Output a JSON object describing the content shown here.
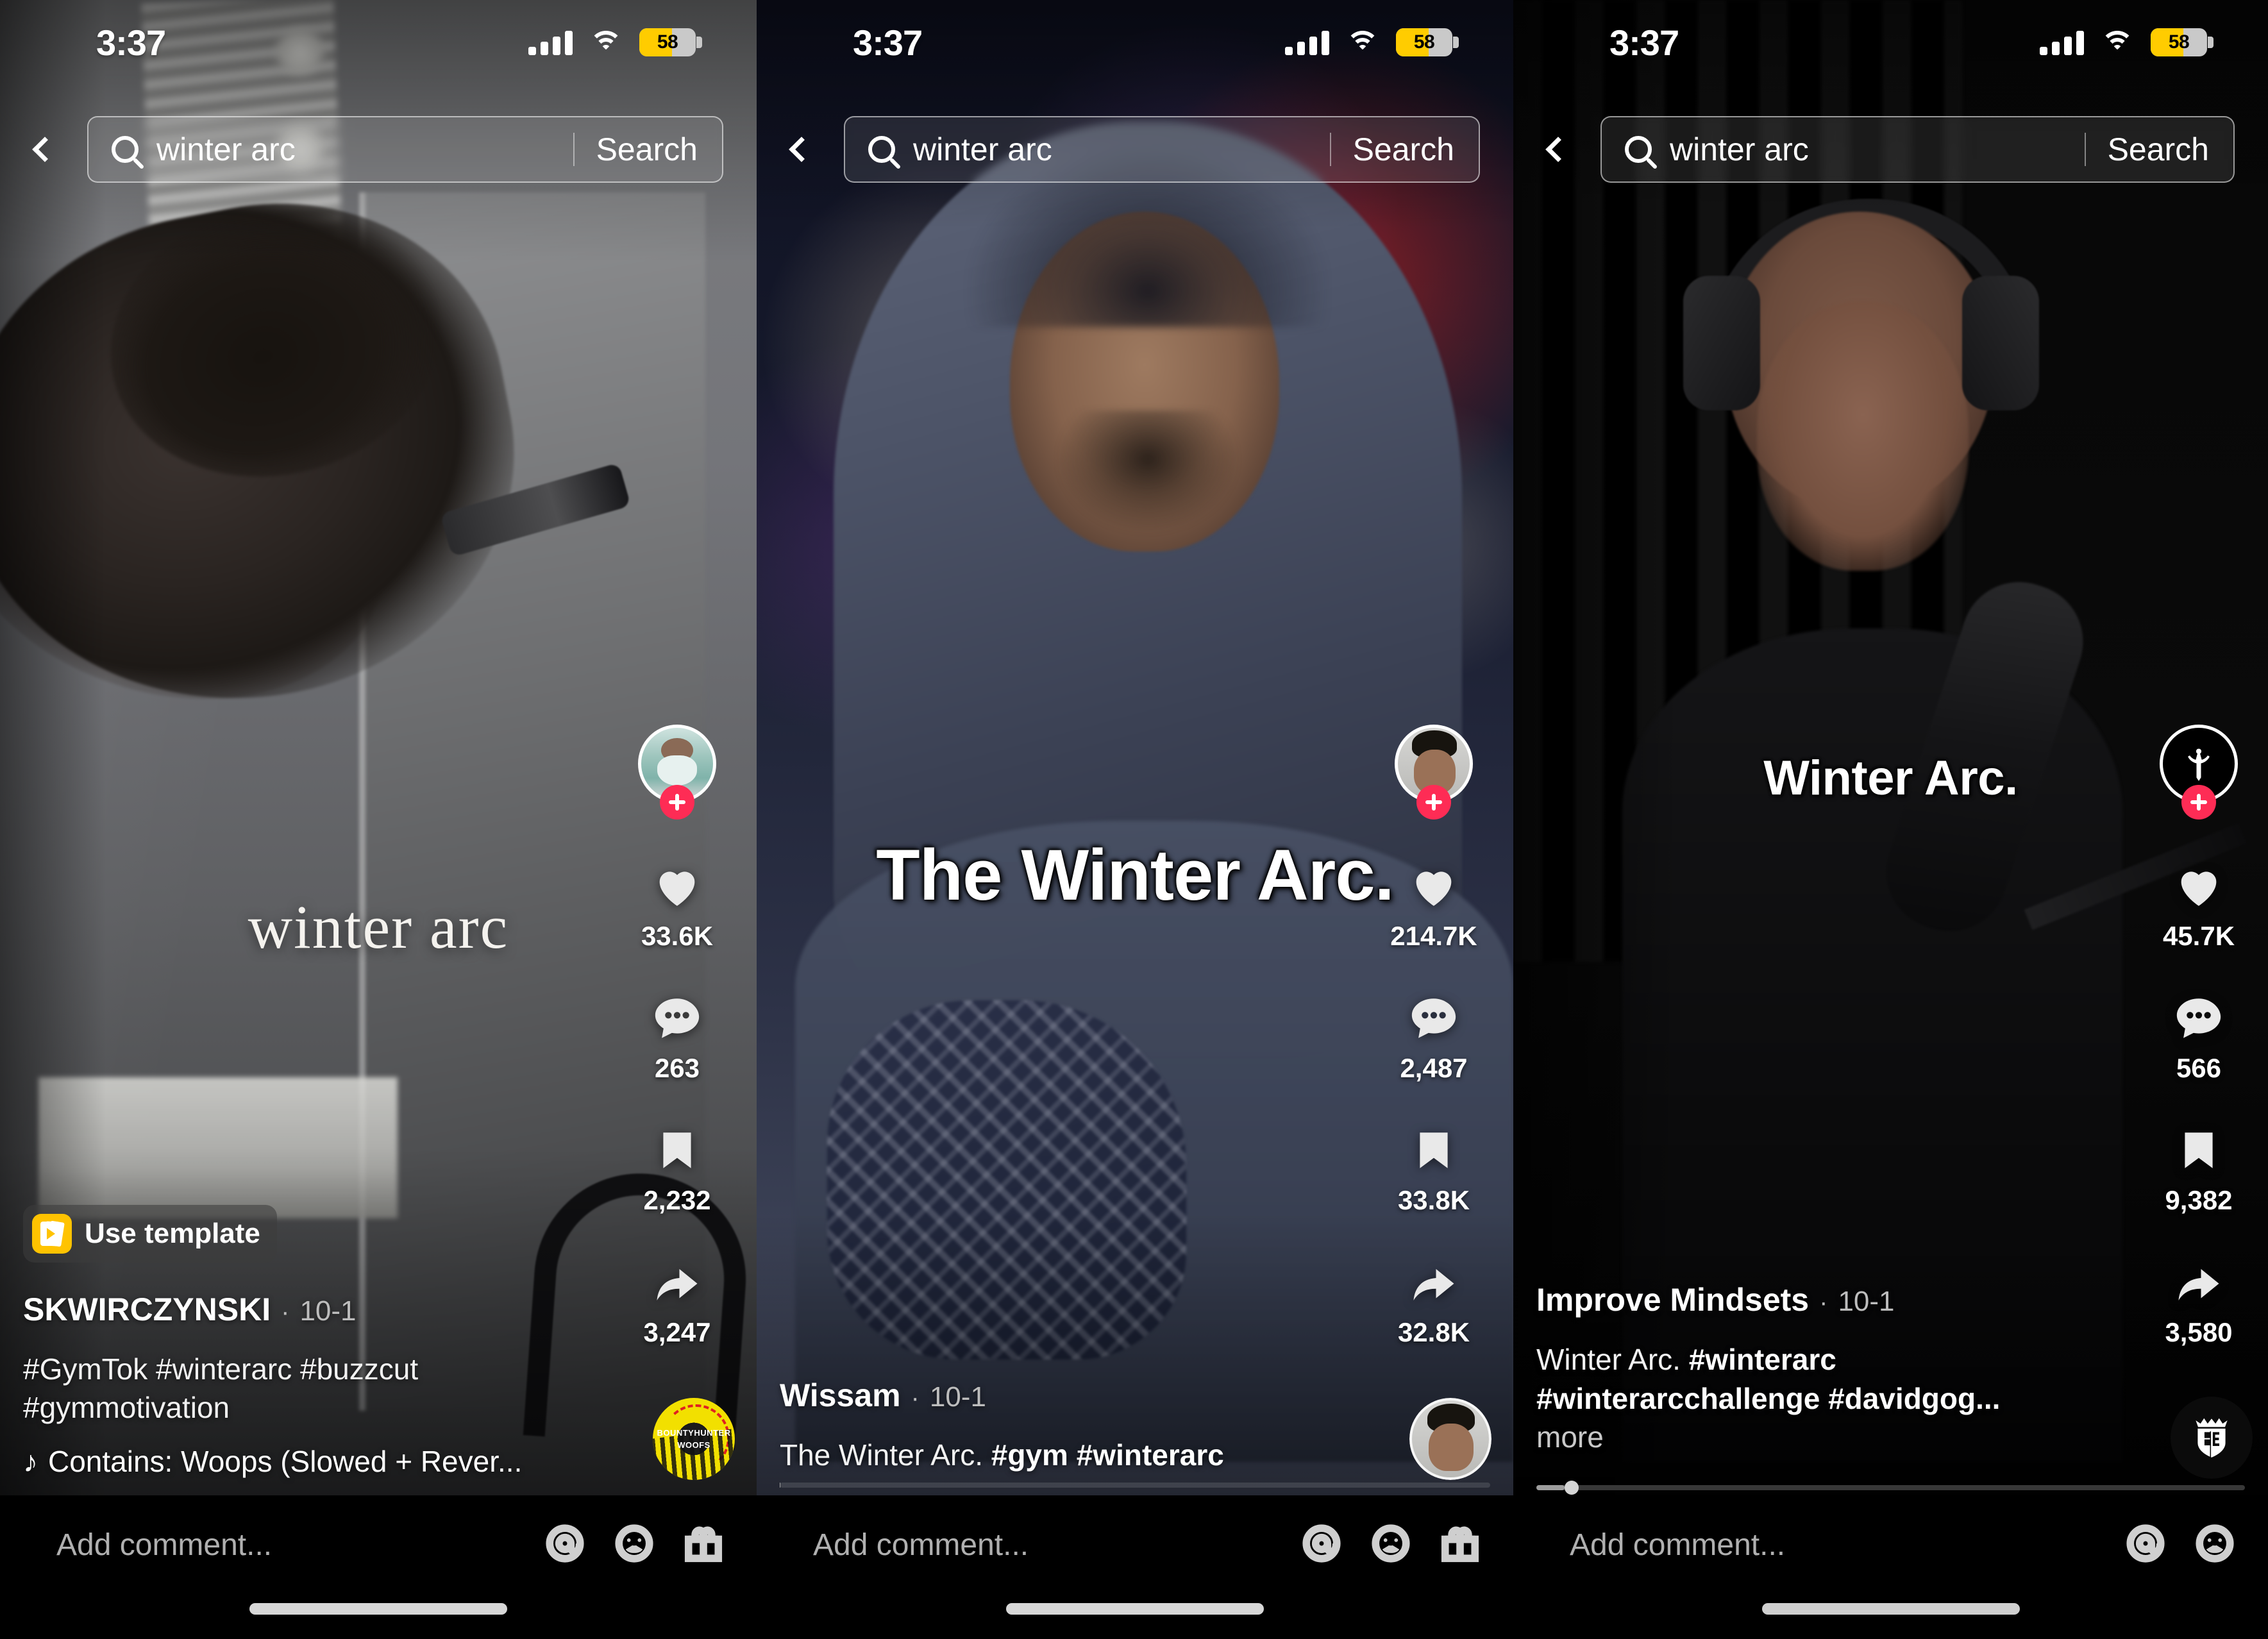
{
  "app": "TikTok search results feed",
  "status_bar": {
    "time": "3:37",
    "battery_percent": "58",
    "wifi": "wifi-icon",
    "signal": "cellular-signal-icon",
    "battery_low_power_color": "#ffcc00"
  },
  "search": {
    "query": "winter arc",
    "placeholder": "Search",
    "button_label": "Search",
    "back_icon": "back-chevron-icon",
    "search_icon": "search-icon"
  },
  "comment_bar": {
    "placeholder": "Add comment...",
    "icons": [
      "mention-at-icon",
      "emoji-smiley-icon",
      "gift-icon"
    ]
  },
  "accent_colors": {
    "follow_button": "#fe2c55",
    "template_badge": "#ffc300",
    "music_disc": "#f2e000"
  },
  "videos": [
    {
      "id": "video-1",
      "overlay_text": "winter arc",
      "overlay_style": "serif",
      "template_badge": {
        "label": "Use template",
        "icon": "template-icon"
      },
      "author": "SKWIRCZYNSKI",
      "separator": "·",
      "date": "10-1",
      "description": "#GymTok #winterarc #buzzcut #gymmotivation",
      "hashtags": [
        "#GymTok",
        "#winterarc",
        "#buzzcut",
        "#gymmotivation"
      ],
      "music_icon": "music-note-icon",
      "music": "Contains: Woops (Slowed + Rever...",
      "disc_label": "BOUNTYHUNTER WOOFS",
      "actions": {
        "avatar": "creator-avatar",
        "follow": "follow-plus-button",
        "like": "33.6K",
        "comment": "263",
        "bookmark": "2,232",
        "share": "3,247"
      }
    },
    {
      "id": "video-2",
      "overlay_text": "The Winter Arc.",
      "overlay_style": "bold",
      "author": "Wissam",
      "separator": "·",
      "date": "10-1",
      "description_plain": "The Winter Arc.",
      "hashtags": [
        "#gym",
        "#winterarc"
      ],
      "actions": {
        "avatar": "creator-avatar",
        "follow": "follow-plus-button",
        "like": "214.7K",
        "comment": "2,487",
        "bookmark": "33.8K",
        "share": "32.8K"
      }
    },
    {
      "id": "video-3",
      "overlay_text": "Winter Arc.",
      "overlay_style": "bold",
      "author": "Improve Mindsets",
      "separator": "·",
      "date": "10-1",
      "description_plain": "Winter Arc.",
      "description_line1_tags": "#winterarc",
      "description_line2": "#winterarcchallenge #davidgog...",
      "more_label": "more",
      "brand_badge": "crown-shield-logo",
      "actions": {
        "avatar": "creator-avatar",
        "follow": "follow-plus-button",
        "like": "45.7K",
        "comment": "566",
        "bookmark": "9,382",
        "share": "3,580"
      }
    }
  ]
}
